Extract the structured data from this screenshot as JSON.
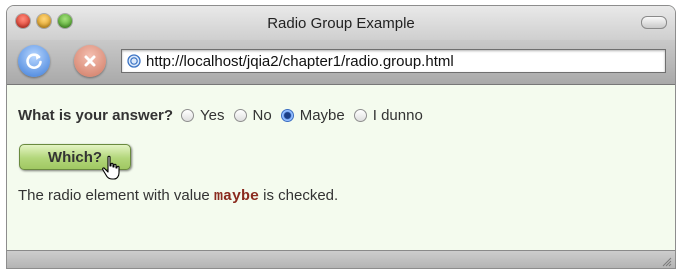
{
  "window": {
    "title": "Radio Group Example"
  },
  "toolbar": {
    "url": "http://localhost/jqia2/chapter1/radio.group.html",
    "reload_icon": "reload-icon",
    "stop_icon": "stop-icon",
    "page_icon": "globe-icon"
  },
  "form": {
    "question": "What is your answer?",
    "options": [
      {
        "label": "Yes",
        "checked": false
      },
      {
        "label": "No",
        "checked": false
      },
      {
        "label": "Maybe",
        "checked": true
      },
      {
        "label": "I dunno",
        "checked": false
      }
    ],
    "button_label": "Which?"
  },
  "result": {
    "prefix": "The radio element with value",
    "value": "maybe",
    "suffix": "is checked."
  },
  "colors": {
    "content_bg": "#f4fbee",
    "button_green": "#b2d67a",
    "code_color": "#8a2a1e"
  }
}
